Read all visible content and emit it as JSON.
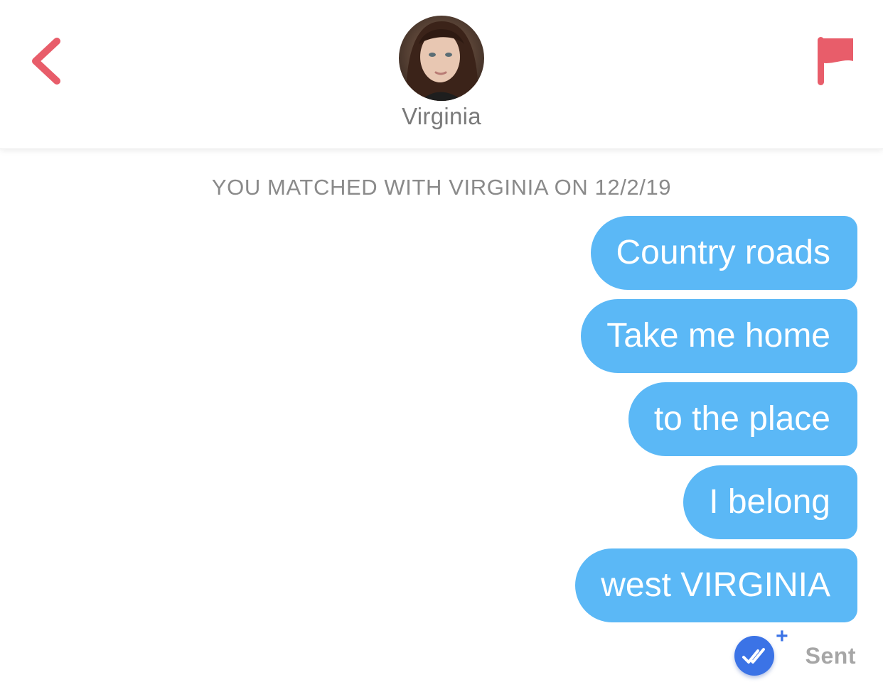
{
  "colors": {
    "accent_red": "#e85d6a",
    "bubble_blue": "#5bb8f6",
    "badge_blue": "#3b73e6",
    "muted_text": "#8a8a8a"
  },
  "header": {
    "back_icon": "chevron-left-icon",
    "profile_name": "Virginia",
    "report_icon": "flag-icon"
  },
  "match_notice": "YOU MATCHED WITH VIRGINIA ON 12/2/19",
  "messages": [
    {
      "text": "Country roads",
      "from": "me"
    },
    {
      "text": "Take me home",
      "from": "me"
    },
    {
      "text": "to the place",
      "from": "me"
    },
    {
      "text": "I belong",
      "from": "me"
    },
    {
      "text": "west VIRGINIA",
      "from": "me"
    }
  ],
  "status": {
    "icon": "double-check-icon",
    "badge_plus": "+",
    "label": "Sent"
  }
}
